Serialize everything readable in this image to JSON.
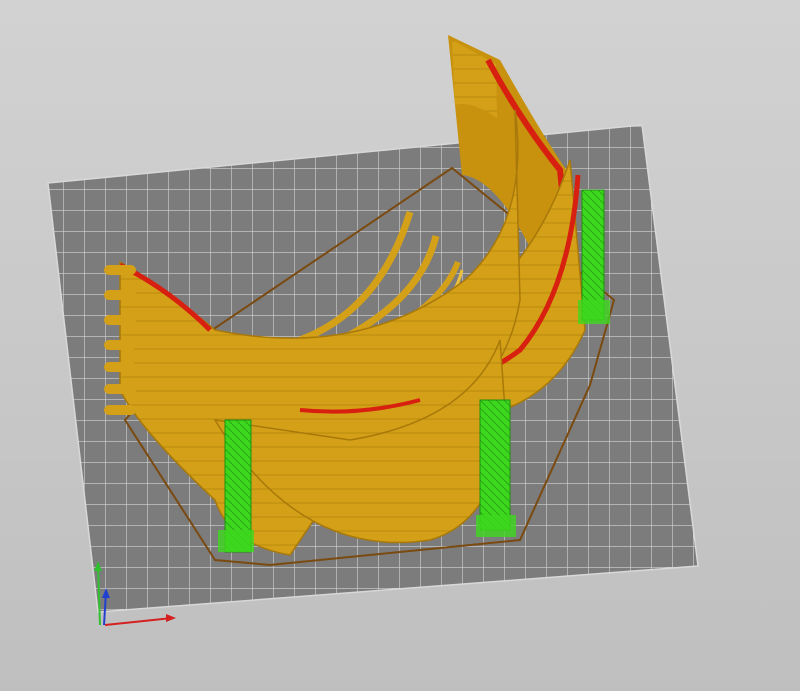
{
  "app": {
    "view": "3d-preview",
    "mode": "sliced-gcode-preview"
  },
  "colors": {
    "background": "#c8c8c8",
    "bed": "#7c7c7c",
    "bed_grid": "#d2d2d2",
    "skirt": "#7a4a10",
    "perimeter": "#d4a017",
    "perimeter_light": "#e9bf3c",
    "perimeter_dark": "#a8790a",
    "overhang": "#d82010",
    "support": "#3dd81e",
    "support_dark": "#1f8f10",
    "axis_x": "#d42020",
    "axis_y": "#30c030",
    "axis_z": "#2040d0"
  },
  "objects": {
    "print_part": "curved-shield-strips",
    "supports": [
      "support-left",
      "support-mid",
      "support-right"
    ]
  },
  "axes": [
    "x-axis",
    "y-axis",
    "z-axis"
  ]
}
